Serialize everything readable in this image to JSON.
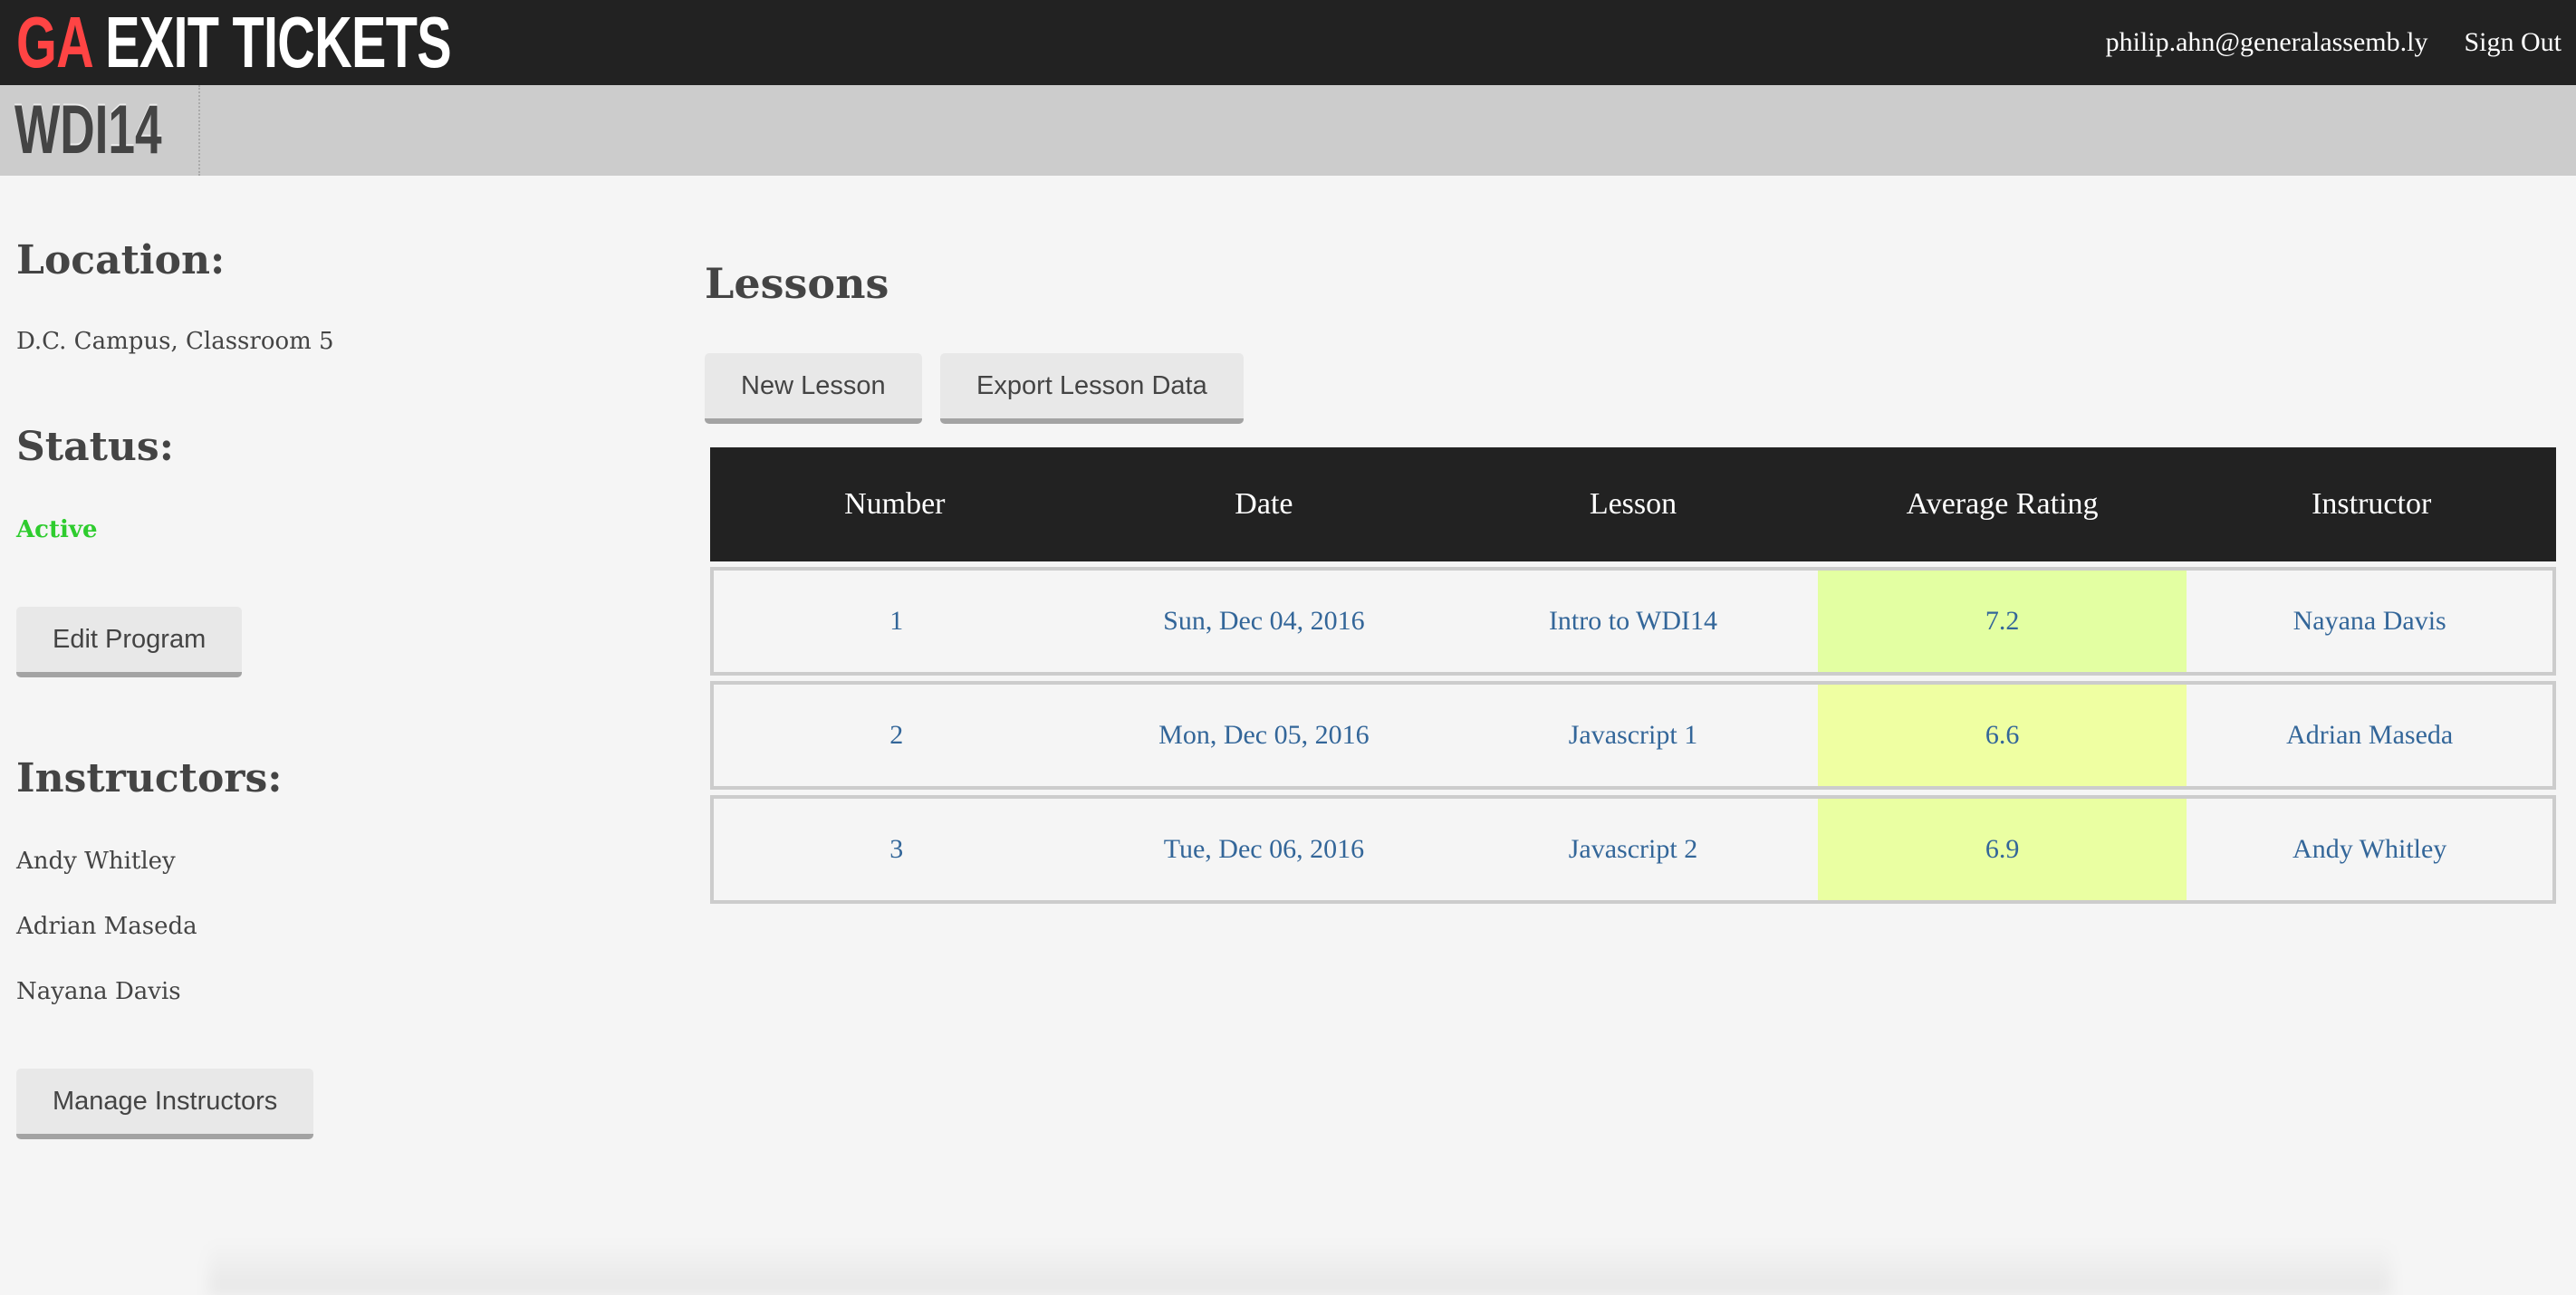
{
  "header": {
    "logo_accent": "GA",
    "logo_text": "EXIT TICKETS",
    "user_email": "philip.ahn@generalassemb.ly",
    "sign_out_label": "Sign Out"
  },
  "program": {
    "name": "WDI14"
  },
  "sidebar": {
    "location_heading": "Location:",
    "location_value": "D.C. Campus, Classroom 5",
    "status_heading": "Status:",
    "status_value": "Active",
    "edit_program_label": "Edit Program",
    "instructors_heading": "Instructors:",
    "instructors": [
      "Andy Whitley",
      "Adrian Maseda",
      "Nayana Davis"
    ],
    "manage_instructors_label": "Manage Instructors"
  },
  "lessons": {
    "title": "Lessons",
    "new_lesson_label": "New Lesson",
    "export_label": "Export Lesson Data",
    "columns": [
      "Number",
      "Date",
      "Lesson",
      "Average Rating",
      "Instructor"
    ],
    "rows": [
      {
        "number": "1",
        "date": "Sun, Dec 04, 2016",
        "lesson": "Intro to WDI14",
        "rating": "7.2",
        "rating_color": "#e3ffa2",
        "instructor": "Nayana Davis"
      },
      {
        "number": "2",
        "date": "Mon, Dec 05, 2016",
        "lesson": "Javascript 1",
        "rating": "6.6",
        "rating_color": "#efffa2",
        "instructor": "Adrian Maseda"
      },
      {
        "number": "3",
        "date": "Tue, Dec 06, 2016",
        "lesson": "Javascript 2",
        "rating": "6.9",
        "rating_color": "#eaffa2",
        "instructor": "Andy Whitley"
      }
    ]
  },
  "colors": {
    "accent_red": "#ff4444",
    "status_active": "#2ecc2e",
    "link_blue": "#336699",
    "header_bg": "#222222"
  }
}
